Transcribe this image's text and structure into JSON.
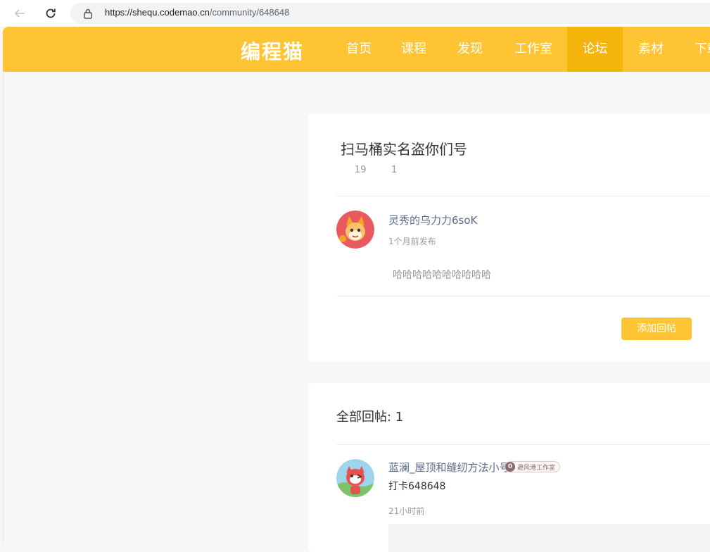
{
  "browser": {
    "url_host": "https://shequ.codemao.cn",
    "url_path": "/community/648648",
    "icons": [
      "back-arrow-icon",
      "reload-icon",
      "lock-icon"
    ]
  },
  "header": {
    "logo": "编程猫",
    "nav": [
      "首页",
      "课程",
      "发现",
      "工作室",
      "论坛",
      "素材",
      "下载"
    ],
    "active_nav": "论坛",
    "colors": {
      "primary": "#fec433",
      "active": "#f5b40a"
    }
  },
  "post": {
    "title": "扫马桶实名盗你们号",
    "views": "19",
    "replies": "1",
    "author": "灵秀的乌力力6soK",
    "time": "1个月前发布",
    "body": "哈哈哈哈哈哈哈哈哈哈",
    "reply_button": "添加回帖"
  },
  "replies": {
    "heading": "全部回帖: 1",
    "items": [
      {
        "author": "蓝澜_屋顶和缝纫方法小号",
        "badge_num": "0",
        "badge_text": "避风港工作室",
        "content": "打卡648648",
        "time": "21小时前"
      }
    ]
  }
}
